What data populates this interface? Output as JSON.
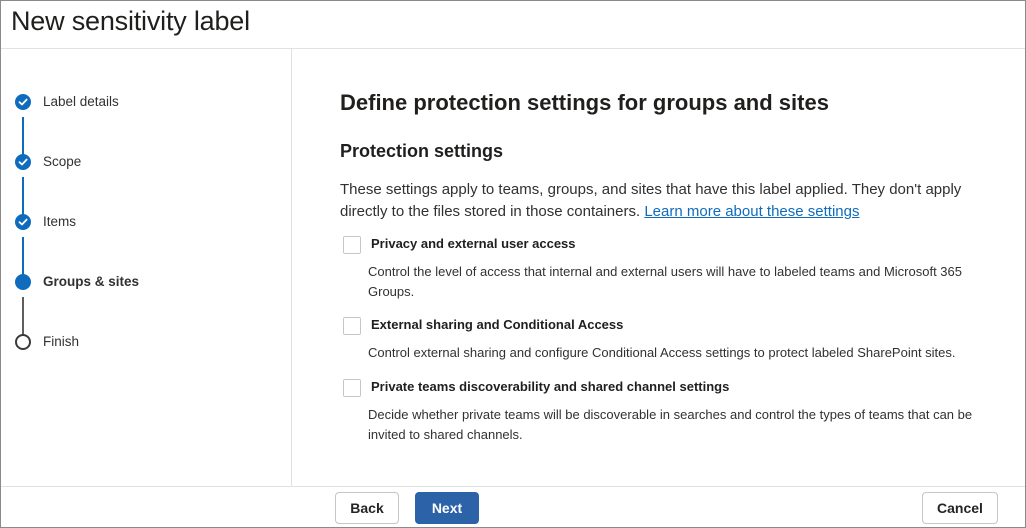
{
  "header": {
    "title": "New sensitivity label"
  },
  "steps": [
    {
      "label": "Label details",
      "state": "done"
    },
    {
      "label": "Scope",
      "state": "done"
    },
    {
      "label": "Items",
      "state": "done"
    },
    {
      "label": "Groups & sites",
      "state": "current"
    },
    {
      "label": "Finish",
      "state": "todo"
    }
  ],
  "main": {
    "heading": "Define protection settings for groups and sites",
    "subheading": "Protection settings",
    "intro_text": "These settings apply to teams, groups, and sites that have this label applied. They don't apply directly to the files stored in those containers.",
    "learn_more_link": "Learn more about these settings",
    "options": [
      {
        "title": "Privacy and external user access",
        "description": "Control the level of access that internal and external users will have to labeled teams and Microsoft 365 Groups.",
        "checked": false
      },
      {
        "title": "External sharing and Conditional Access",
        "description": "Control external sharing and configure Conditional Access settings to protect labeled SharePoint sites.",
        "checked": false
      },
      {
        "title": "Private teams discoverability and shared channel settings",
        "description": "Decide whether private teams will be discoverable in searches and control the types of teams that can be invited to shared channels.",
        "checked": false
      }
    ]
  },
  "footer": {
    "back_label": "Back",
    "next_label": "Next",
    "cancel_label": "Cancel"
  },
  "colors": {
    "accent": "#0f6cbd",
    "primary_button": "#2b62a8"
  }
}
